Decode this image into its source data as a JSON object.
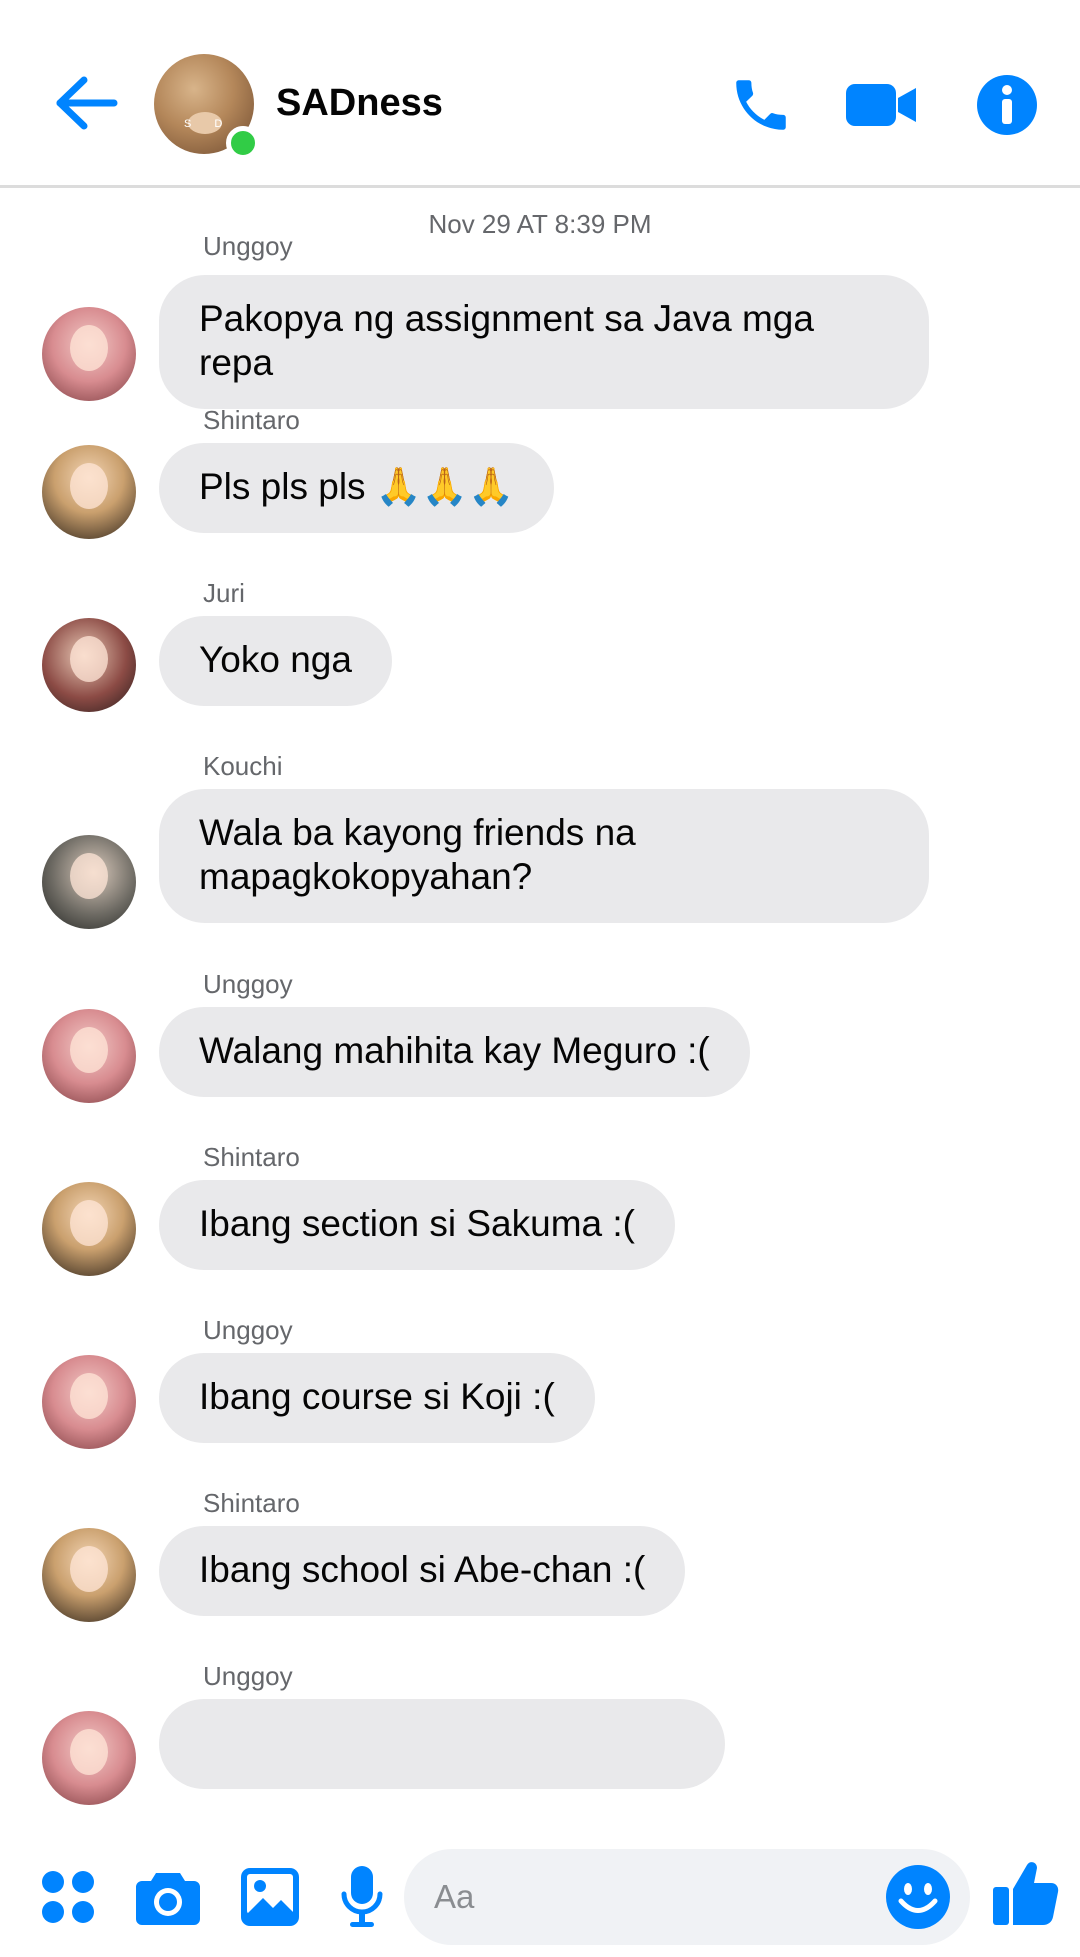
{
  "header": {
    "title": "SADness",
    "avatar_text": "S D"
  },
  "timestamp": "Nov 29 AT 8:39 PM",
  "messages": [
    {
      "sender": "Unggoy",
      "text_lines": [
        "Pakopya ng assignment sa Java mga",
        "repa"
      ]
    },
    {
      "sender": "Shintaro",
      "text": "Pls pls pls 🙏🙏🙏"
    },
    {
      "sender": "Juri",
      "text": "Yoko nga"
    },
    {
      "sender": "Kouchi",
      "text_lines": [
        "Wala ba kayong friends na",
        "mapagkokopyahan?"
      ]
    },
    {
      "sender": "Unggoy",
      "text": "Walang mahihita kay Meguro :("
    },
    {
      "sender": "Shintaro",
      "text": "Ibang section si Sakuma :("
    },
    {
      "sender": "Unggoy",
      "text": "Ibang course si Koji :("
    },
    {
      "sender": "Shintaro",
      "text": "Ibang school si Abe-chan :("
    },
    {
      "sender": "Unggoy",
      "text": ""
    }
  ],
  "composer": {
    "placeholder": "Aa"
  },
  "colors": {
    "accent": "#0084ff",
    "bubble": "#e9e9eb",
    "online": "#31cc46",
    "meta_text": "#65676b"
  },
  "icons": {
    "back": "arrow-left-icon",
    "call": "phone-icon",
    "video": "video-camera-icon",
    "info": "info-icon",
    "menu": "four-dots-icon",
    "camera": "camera-icon",
    "gallery": "image-icon",
    "mic": "microphone-icon",
    "emoji": "smiley-icon",
    "like": "thumbs-up-icon"
  }
}
